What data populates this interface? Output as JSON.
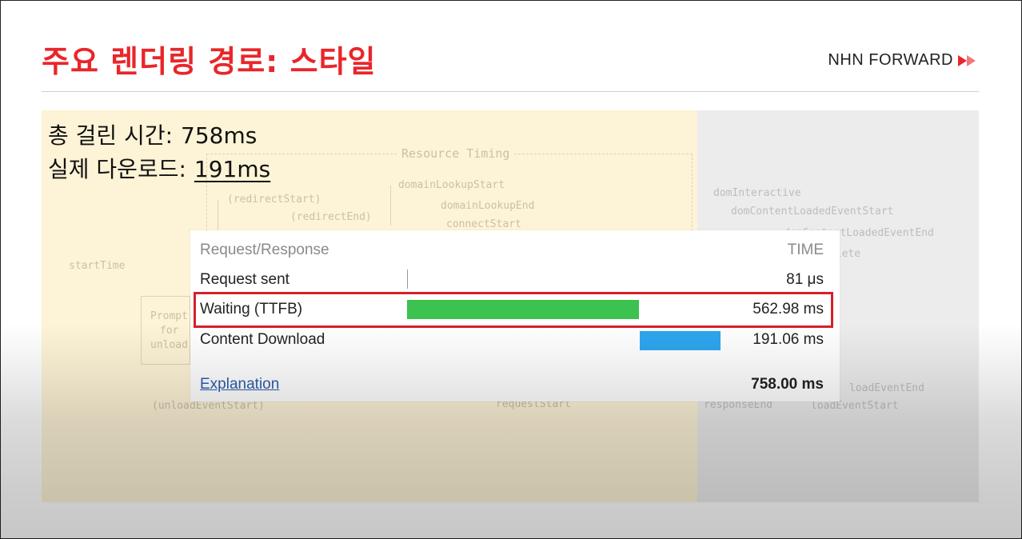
{
  "slide": {
    "title": "주요 렌더링 경로: 스타일",
    "brand": "NHN FORWARD",
    "brand_icon": "double-play-arrow-icon",
    "colors": {
      "title": "#e8262a",
      "waiting_bar": "#3cc24f",
      "download_bar": "#2ea6ee",
      "highlight": "#d6202a"
    }
  },
  "stats": {
    "total_label": "총 걸린 시간:",
    "total_value": "758ms",
    "download_label": "실제 다운로드:",
    "download_value": "191ms"
  },
  "diagram": {
    "resource_timing": "Resource Timing",
    "domain_lookup_start": "domainLookupStart",
    "domain_lookup_end": "domainLookupEnd",
    "connect_start": "connectStart",
    "redirect_start": "(redirectStart)",
    "redirect_end": "(redirectEnd)",
    "start_time": "startTime",
    "prompt_line1": "Prompt",
    "prompt_line2": "for",
    "prompt_line3": "unload",
    "unload_event_start": "(unloadEventStart)",
    "request_start": "requestStart",
    "dom_interactive": "domInteractive",
    "dom_content_loaded_start": "domContentLoadedEventStart",
    "dom_content_loaded_end": "domContentLoadedEventEnd",
    "dom_complete": "domComplete",
    "response_end": "responseEnd",
    "load_event_end": "loadEventEnd",
    "load_event_start": "loadEventStart"
  },
  "timing": {
    "header_label": "Request/Response",
    "header_time": "TIME",
    "rows": [
      {
        "label": "Request sent",
        "value": "81 μs"
      },
      {
        "label": "Waiting (TTFB)",
        "value": "562.98 ms",
        "bar_start": 0.0,
        "bar_end": 0.742
      },
      {
        "label": "Content Download",
        "value": "191.06 ms",
        "bar_start": 0.742,
        "bar_end": 1.0
      }
    ],
    "explanation_link": "Explanation",
    "total": "758.00 ms"
  }
}
